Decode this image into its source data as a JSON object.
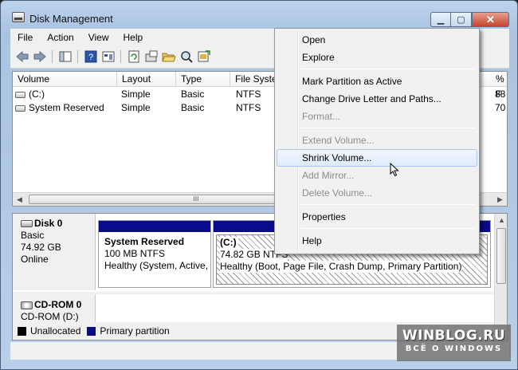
{
  "window": {
    "title": "Disk Management",
    "minimize": "▁",
    "maximize": "▢",
    "close": "✕"
  },
  "menubar": {
    "items": [
      "File",
      "Action",
      "View",
      "Help"
    ]
  },
  "toolbar": {
    "icons": [
      "back-arrow-icon",
      "forward-arrow-icon",
      "console-tree-icon",
      "help-icon",
      "properties-icon",
      "refresh-icon",
      "disk-properties-icon",
      "open-folder-icon",
      "search-icon",
      "export-icon"
    ]
  },
  "volume_list": {
    "columns": [
      "Volume",
      "Layout",
      "Type",
      "File Syste",
      "% F"
    ],
    "rows": [
      {
        "volume": "(C:)",
        "layout": "Simple",
        "type": "Basic",
        "fs": "NTFS",
        "pct": "88"
      },
      {
        "volume": "System Reserved",
        "layout": "Simple",
        "type": "Basic",
        "fs": "NTFS",
        "pct": "70"
      }
    ],
    "scroll_grip": "III"
  },
  "disks": [
    {
      "name": "Disk 0",
      "kind": "Basic",
      "size": "74.92 GB",
      "status": "Online",
      "partitions": [
        {
          "name": "System Reserved",
          "size": "100 MB NTFS",
          "health": "Healthy (System, Active,"
        },
        {
          "name": "(C:)",
          "size": "74.82 GB NTFS",
          "health": "Healthy (Boot, Page File, Crash Dump, Primary Partition)"
        }
      ]
    },
    {
      "name": "CD-ROM 0",
      "kind": "CD-ROM (D:)"
    }
  ],
  "legend": [
    {
      "label": "Unallocated",
      "color": "#000000"
    },
    {
      "label": "Primary partition",
      "color": "#0a0a8c"
    }
  ],
  "context_menu": {
    "items": [
      {
        "label": "Open",
        "enabled": true
      },
      {
        "label": "Explore",
        "enabled": true
      },
      {
        "label": "Mark Partition as Active",
        "enabled": true
      },
      {
        "label": "Change Drive Letter and Paths...",
        "enabled": true
      },
      {
        "label": "Format...",
        "enabled": false
      },
      {
        "label": "Extend Volume...",
        "enabled": false
      },
      {
        "label": "Shrink Volume...",
        "enabled": true,
        "highlighted": true
      },
      {
        "label": "Add Mirror...",
        "enabled": false
      },
      {
        "label": "Delete Volume...",
        "enabled": false
      },
      {
        "label": "Properties",
        "enabled": true
      },
      {
        "label": "Help",
        "enabled": true
      }
    ]
  },
  "watermark": {
    "main": "WINBLOG.RU",
    "sub": "ВСЁ О WINDOWS"
  },
  "colors": {
    "primary_partition": "#0a0a8c",
    "menu_highlight": "#dfeafb"
  }
}
